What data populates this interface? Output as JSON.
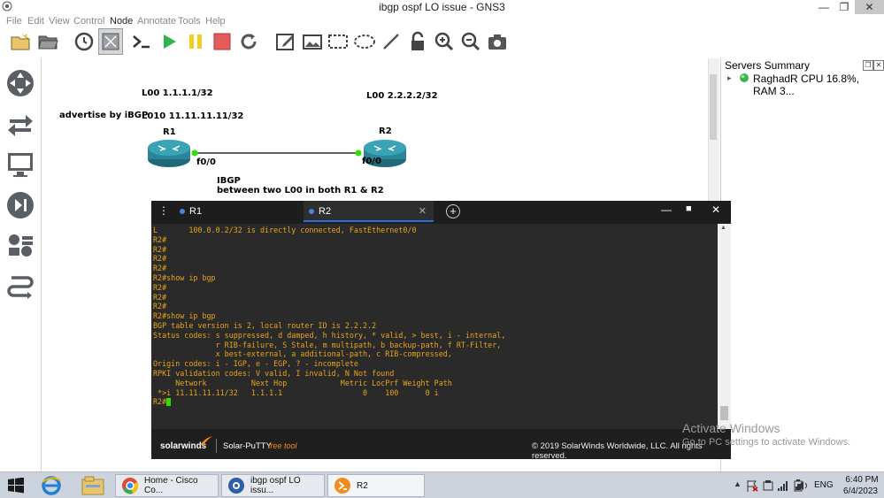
{
  "window": {
    "title": "ibgp ospf LO issue - GNS3",
    "controls": [
      "minimize",
      "maximize",
      "close"
    ]
  },
  "menu": [
    "File",
    "Edit",
    "View",
    "Control",
    "Node",
    "Annotate",
    "Tools",
    "Help"
  ],
  "toolbar": [
    "console-all",
    "play",
    "pause",
    "stop",
    "reload",
    "note",
    "picture",
    "rectangle",
    "ellipse",
    "line",
    "lock",
    "zoom-in",
    "zoom-out",
    "screenshot"
  ],
  "topology": {
    "r1_loopbacks": "L00 1.1.1.1/32",
    "r1_loopback10": "L010 11.11.11.11/32",
    "r2_loopbacks": "L00 2.2.2.2/32",
    "advertise_note": "advertise by iBGP",
    "r1_name": "R1",
    "r2_name": "R2",
    "r1_port": "f0/0",
    "r2_port": "f0/0",
    "ibgp_note_line1": "IBGP",
    "ibgp_note_line2": "between two L00 in both R1 & R2"
  },
  "servers_summary": {
    "title": "Servers Summary",
    "server": "RaghadR CPU 16.8%, RAM 3..."
  },
  "putty": {
    "tabs": [
      {
        "label": "R1",
        "active": false
      },
      {
        "label": "R2",
        "active": true
      }
    ],
    "lines": [
      "L       100.0.0.2/32 is directly connected, FastEthernet0/0",
      "R2#",
      "R2#",
      "R2#",
      "R2#",
      "R2#show ip bgp",
      "R2#",
      "R2#",
      "R2#",
      "R2#show ip bgp",
      "BGP table version is 2, local router ID is 2.2.2.2",
      "Status codes: s suppressed, d damped, h history, * valid, > best, i - internal,",
      "              r RIB-failure, S Stale, m multipath, b backup-path, f RT-Filter,",
      "              x best-external, a additional-path, c RIB-compressed,",
      "Origin codes: i - IGP, e - EGP, ? - incomplete",
      "RPKI validation codes: V valid, I invalid, N Not found",
      "",
      "     Network          Next Hop            Metric LocPrf Weight Path",
      " *>i 11.11.11.11/32   1.1.1.1                  0    100      0 i"
    ],
    "prompt": "R2#",
    "brand": "solarwinds",
    "product": "Solar-PuTTY",
    "product_tag": "free tool",
    "copyright": "© 2019 SolarWinds Worldwide, LLC. All rights reserved."
  },
  "watermark": {
    "line1": "Activate Windows",
    "line2": "Go to PC settings to activate Windows."
  },
  "taskbar": {
    "items": [
      {
        "label": "Home - Cisco Co...",
        "icon": "chrome-icon"
      },
      {
        "label": "ibgp ospf LO issu...",
        "icon": "gns3-icon"
      },
      {
        "label": "R2",
        "icon": "putty-icon"
      }
    ],
    "language": "ENG",
    "time": "6:40 PM",
    "date": "6/4/2023"
  }
}
